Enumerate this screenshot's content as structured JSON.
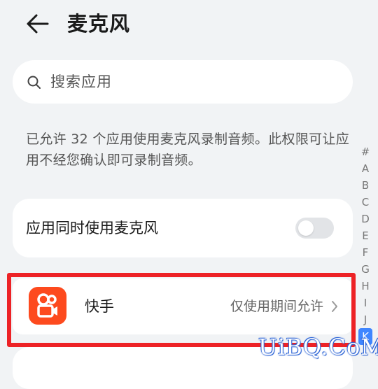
{
  "header": {
    "title": "麦克风",
    "back_icon": "back-arrow-icon"
  },
  "search": {
    "placeholder": "搜索应用",
    "icon": "search-icon"
  },
  "description": "已允许 32 个应用使用麦克风录制音频。此权限可让应用不经您确认即可录制音频。",
  "toggle_card": {
    "label": "应用同时使用麦克风",
    "state": "off"
  },
  "apps": [
    {
      "name": "快手",
      "status": "仅使用期间允许",
      "icon": "kuaishou-icon",
      "icon_color": "#fd4a1e",
      "highlighted": true
    }
  ],
  "alpha_index": {
    "letters": [
      "#",
      "A",
      "B",
      "C",
      "D",
      "E",
      "F",
      "G",
      "H",
      "I",
      "J",
      "K"
    ],
    "active": "K",
    "accent": "#3f86ff"
  },
  "highlight_color": "#ed2226",
  "watermark": "UiBQ.CoM"
}
